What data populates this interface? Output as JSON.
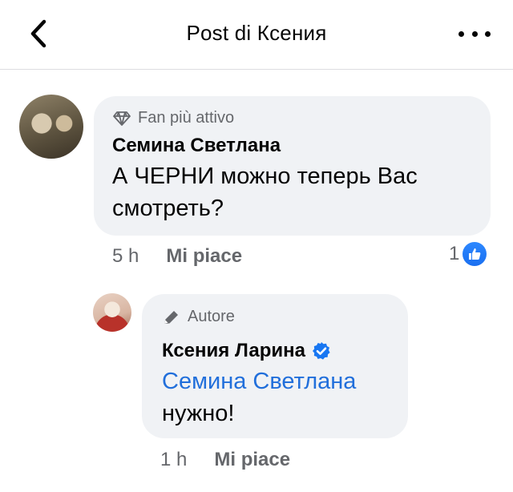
{
  "header": {
    "title": "Post di Ксения",
    "back_icon": "chevron-left-icon",
    "more_icon": "more-dots-icon"
  },
  "comments": [
    {
      "badge": "Fan più attivo",
      "badge_icon": "diamond-icon",
      "author": "Семина Светлана",
      "text": "А ЧЕРНИ можно теперь Вас смотреть?",
      "time": "5 h",
      "like_label": "Mi piace",
      "reaction_count": "1",
      "reaction_icon": "thumbs-up-icon"
    },
    {
      "badge": "Autore",
      "badge_icon": "pencil-icon",
      "author": "Ксения Ларина",
      "verified_icon": "verified-badge-icon",
      "mention": "Семина Светлана",
      "text": "нужно!",
      "time": "1 h",
      "like_label": "Mi piace"
    }
  ],
  "colors": {
    "accent_blue": "#216fdb",
    "bubble_bg": "#f0f2f5",
    "secondary_text": "#65676b"
  }
}
